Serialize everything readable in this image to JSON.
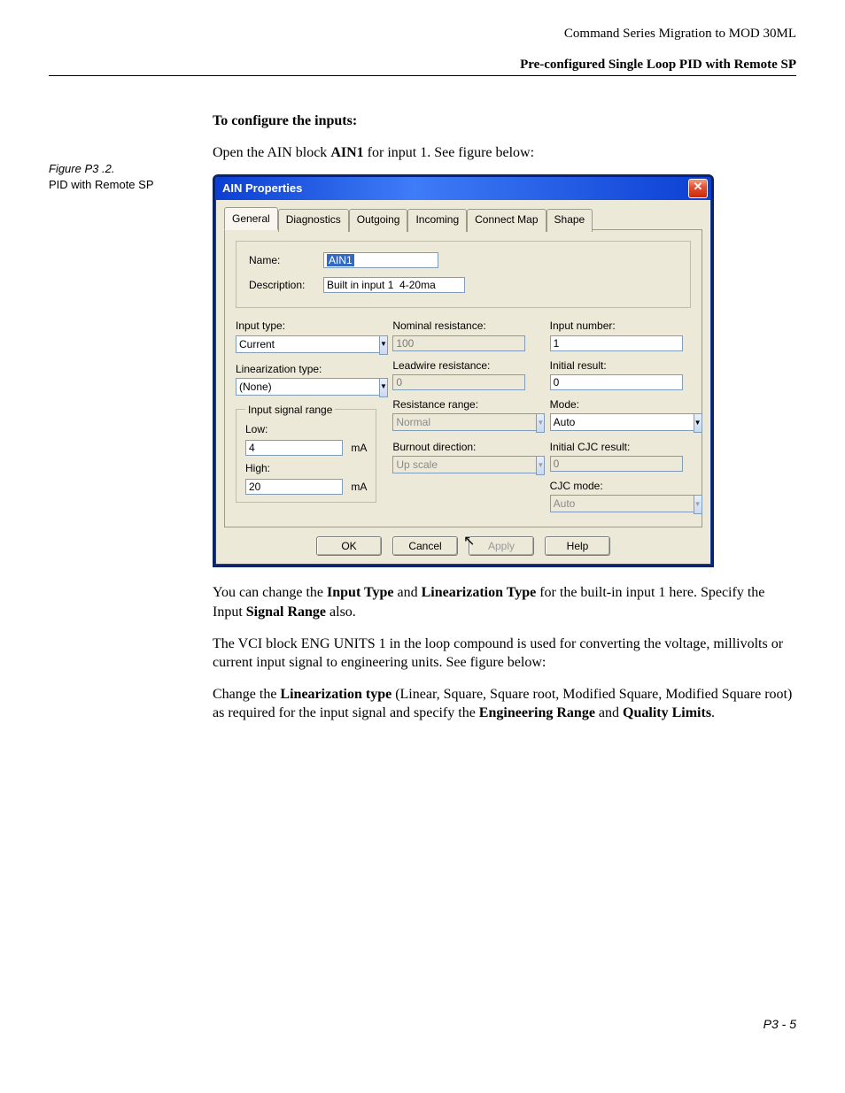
{
  "header": {
    "running": "Command Series Migration to MOD 30ML",
    "section": "Pre-configured Single Loop PID with Remote SP"
  },
  "sidebar": {
    "figure_label": "Figure P3 .2.",
    "figure_caption": "PID with Remote SP"
  },
  "body": {
    "heading": "To configure the inputs:",
    "p1_a": "Open the AIN block ",
    "p1_b": "AIN1",
    "p1_c": " for input 1. See figure below:",
    "p2_a": "You can change the ",
    "p2_b": "Input Type",
    "p2_c": " and ",
    "p2_d": "Linearization Type",
    "p2_e": " for the built-in input 1 here. Specify the Input ",
    "p2_f": "Signal Range",
    "p2_g": " also.",
    "p3": "The VCI block ENG UNITS 1 in the loop compound is used for converting the voltage, millivolts or current input signal to engineering units. See figure below:",
    "p4_a": "Change the ",
    "p4_b": "Linearization type",
    "p4_c": " (Linear, Square, Square root, Modified Square, Modified Square root) as required for the input signal and specify the ",
    "p4_d": "Engineering Range",
    "p4_e": " and ",
    "p4_f": "Quality Limits",
    "p4_g": "."
  },
  "dialog": {
    "title": "AIN Properties",
    "close_glyph": "✕",
    "tabs": [
      "General",
      "Diagnostics",
      "Outgoing",
      "Incoming",
      "Connect Map",
      "Shape"
    ],
    "name_label": "Name:",
    "name_value": "AIN1",
    "desc_label": "Description:",
    "desc_value": "Built in input 1  4-20ma",
    "col1": {
      "input_type_label": "Input type:",
      "input_type_value": "Current",
      "lin_type_label": "Linearization type:",
      "lin_type_value": "(None)",
      "range_legend": "Input signal range",
      "low_label": "Low:",
      "low_value": "4",
      "high_label": "High:",
      "high_value": "20",
      "unit": "mA"
    },
    "col2": {
      "nom_res_label": "Nominal resistance:",
      "nom_res_value": "100",
      "lead_res_label": "Leadwire resistance:",
      "lead_res_value": "0",
      "res_range_label": "Resistance range:",
      "res_range_value": "Normal",
      "burnout_label": "Burnout direction:",
      "burnout_value": "Up scale"
    },
    "col3": {
      "input_num_label": "Input number:",
      "input_num_value": "1",
      "init_result_label": "Initial result:",
      "init_result_value": "0",
      "mode_label": "Mode:",
      "mode_value": "Auto",
      "init_cjc_label": "Initial CJC result:",
      "init_cjc_value": "0",
      "cjc_mode_label": "CJC mode:",
      "cjc_mode_value": "Auto"
    },
    "buttons": {
      "ok": "OK",
      "cancel": "Cancel",
      "apply": "Apply",
      "help": "Help"
    }
  },
  "footer": {
    "pagenum": "P3 - 5"
  }
}
